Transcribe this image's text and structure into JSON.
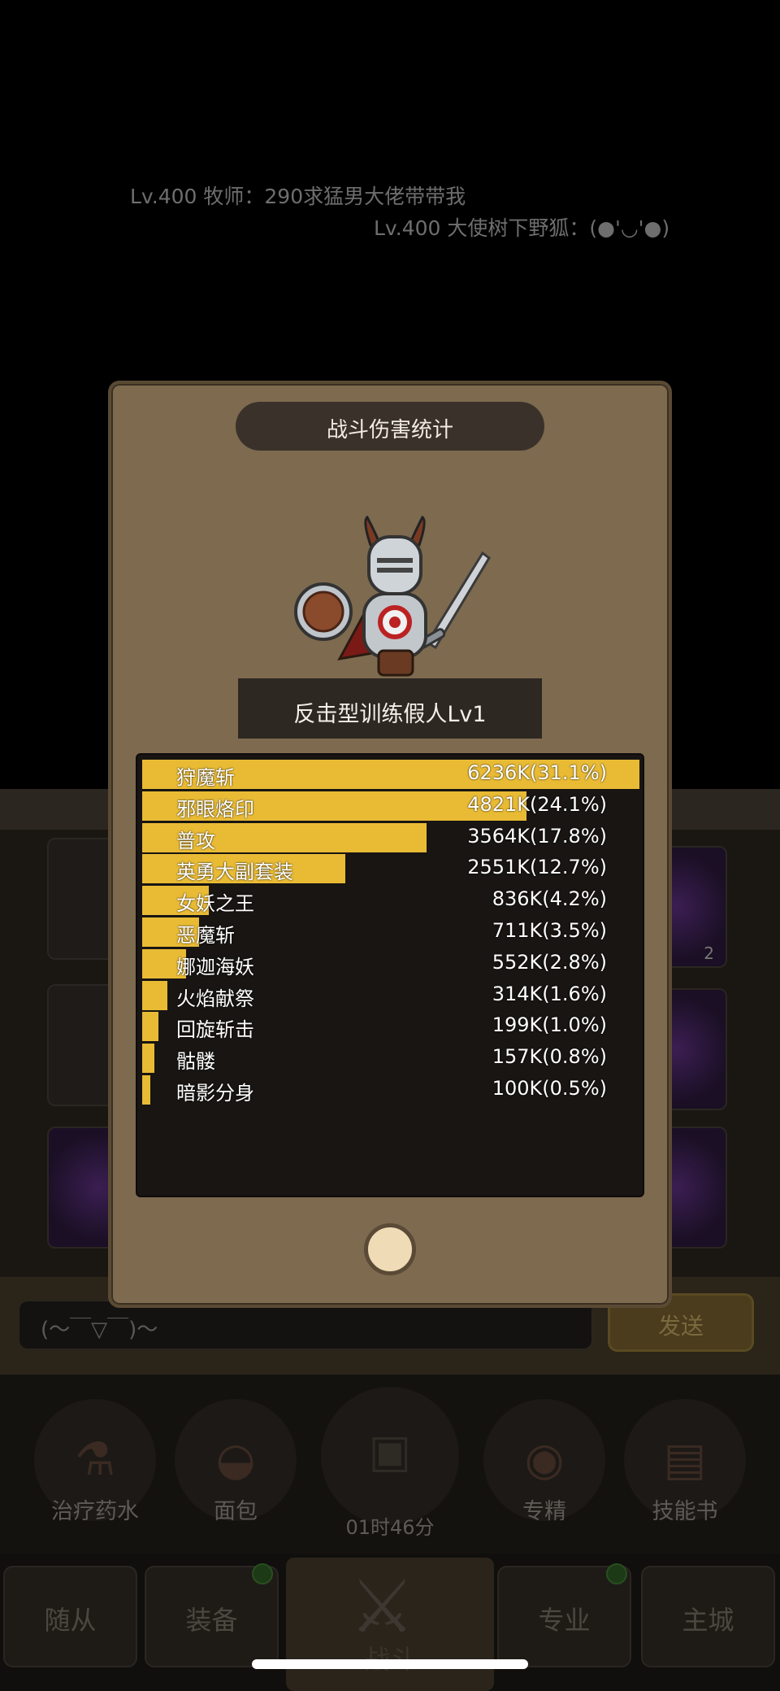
{
  "chat": {
    "line1": "Lv.400 牧师：290求猛男大佬带带我",
    "line2": "Lv.400 大使树下野狐：(●'◡'●)"
  },
  "background": {
    "tile_count_label": "2",
    "chat_input_placeholder": "(～￣▽￣)～",
    "send_label": "发送",
    "items": [
      {
        "label": "治疗药水",
        "icon": "potion-icon"
      },
      {
        "label": "面包",
        "icon": "bread-icon"
      },
      {
        "label": "专精",
        "icon": "specialization-icon"
      },
      {
        "label": "技能书",
        "icon": "skill-book-icon"
      }
    ],
    "chest_timer": "01时46分",
    "nav": {
      "follower": "随从",
      "equipment": "装备",
      "battle": "战斗",
      "profession": "专业",
      "main_city": "主城"
    }
  },
  "dialog": {
    "title": "战斗伤害统计",
    "target_name": "反击型训练假人Lv1",
    "bar_color": "#e9bb35"
  },
  "chart_data": {
    "type": "bar",
    "orientation": "horizontal",
    "categories": [
      "狩魔斩",
      "邪眼烙印",
      "普攻",
      "英勇大副套装",
      "女妖之王",
      "恶魔斩",
      "娜迦海妖",
      "火焰献祭",
      "回旋斩击",
      "骷髅",
      "暗影分身"
    ],
    "value_labels": [
      "6236K(31.1%)",
      "4821K(24.1%)",
      "3564K(17.8%)",
      "2551K(12.7%)",
      "836K(4.2%)",
      "711K(3.5%)",
      "552K(2.8%)",
      "314K(1.6%)",
      "199K(1.0%)",
      "157K(0.8%)",
      "100K(0.5%)"
    ],
    "values": [
      6236,
      4821,
      3564,
      2551,
      836,
      711,
      552,
      314,
      199,
      157,
      100
    ],
    "percent": [
      31.1,
      24.1,
      17.8,
      12.7,
      4.2,
      3.5,
      2.8,
      1.6,
      1.0,
      0.8,
      0.5
    ]
  }
}
